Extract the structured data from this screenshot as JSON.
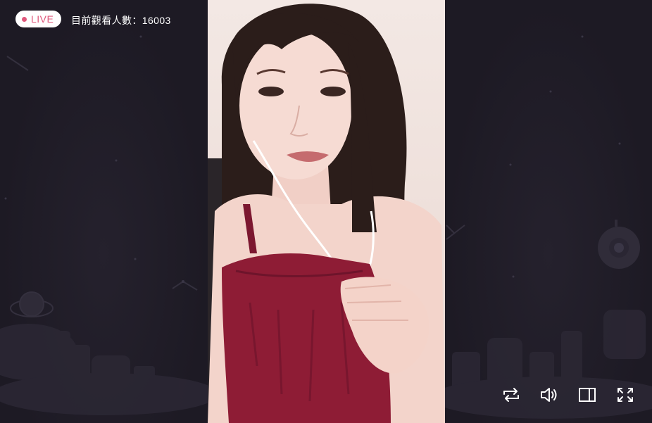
{
  "stream": {
    "live_label": "LIVE",
    "viewer_count_text": "目前觀看人數：16003"
  },
  "controls": [
    {
      "name": "loop-button",
      "icon": "loop-icon"
    },
    {
      "name": "volume-button",
      "icon": "volume-icon"
    },
    {
      "name": "side-panel-button",
      "icon": "side-panel-icon"
    },
    {
      "name": "fullscreen-button",
      "icon": "fullscreen-icon"
    }
  ],
  "colors": {
    "live_accent": "#e0587c",
    "background": "#1d1a24",
    "icon_color": "#ffffff"
  }
}
